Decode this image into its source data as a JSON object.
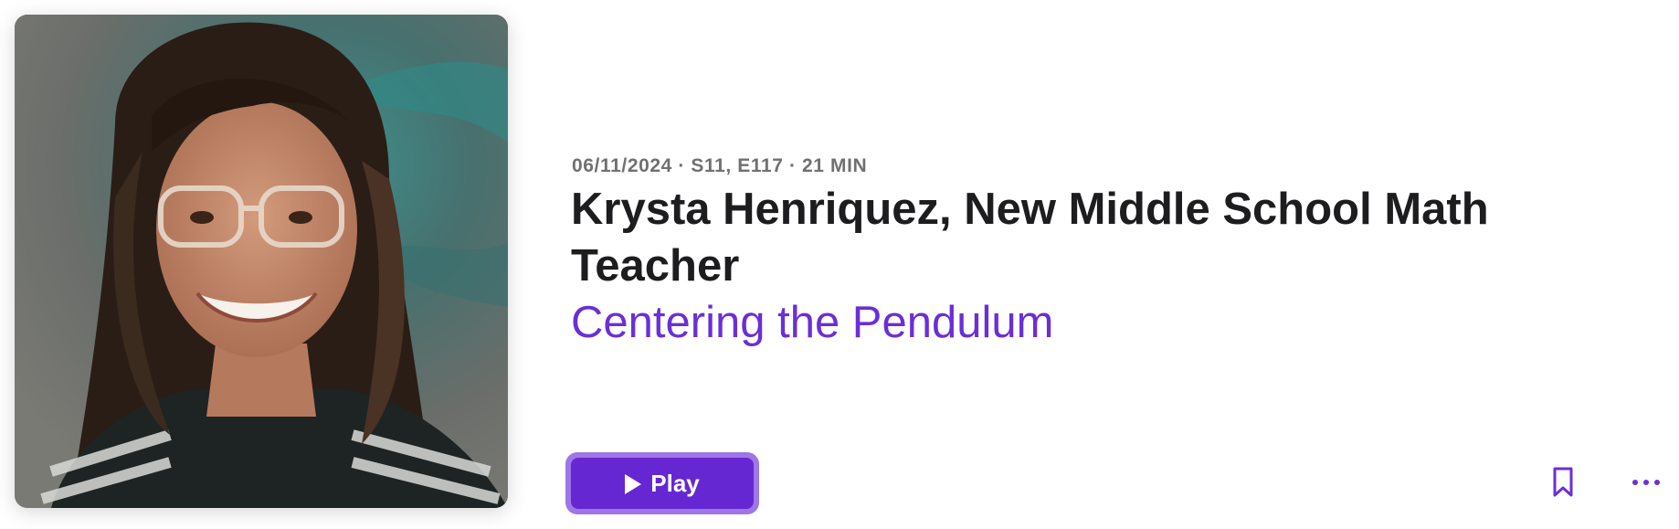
{
  "episode": {
    "meta": "06/11/2024 · S11, E117 · 21 MIN",
    "title": "Krysta Henriquez, New Middle School Math Teacher",
    "show_name": "Centering the Pendulum"
  },
  "actions": {
    "play_label": "Play",
    "bookmark_icon": "bookmark-icon",
    "more_icon": "more-dots-icon"
  },
  "colors": {
    "accent": "#6a2fd6",
    "play_button": "#6527d2",
    "play_focus_ring": "#9e76e6",
    "title_text": "#1d1d1f",
    "meta_text": "#707070"
  }
}
